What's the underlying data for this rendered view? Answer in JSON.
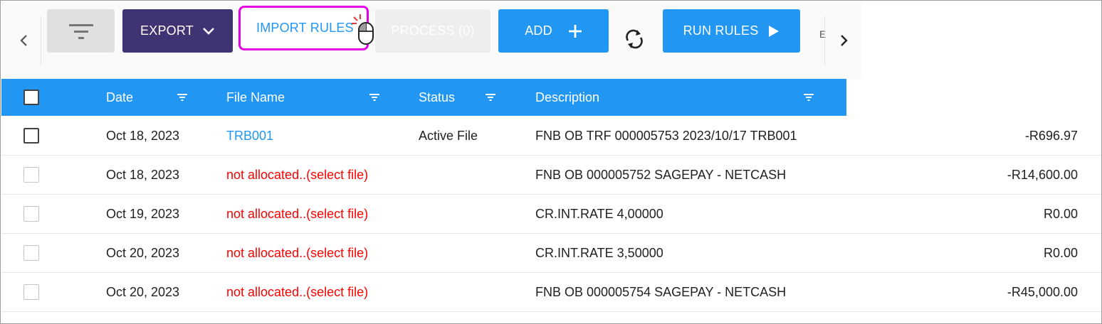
{
  "toolbar": {
    "export_label": "EXPORT",
    "import_rules_label": "IMPORT RULES",
    "process_label": "PROCESS (0)",
    "add_label": "ADD",
    "run_rules_label": "RUN RULES",
    "overflow_label": "E",
    "accent": "#2196f3",
    "export_color": "#3f3373",
    "highlight_color": "#e600e6"
  },
  "table": {
    "header_color": "#2196f3",
    "columns": [
      "Date",
      "File Name",
      "Status",
      "Description"
    ],
    "rows": [
      {
        "date": "Oct 18, 2023",
        "file": "TRB001",
        "status": "Active File",
        "description": "FNB OB TRF 000005753 2023/10/17 TRB001",
        "amount": "-R696.97"
      },
      {
        "date": "Oct 18, 2023",
        "file": "not allocated..(select file)",
        "status": "",
        "description": "FNB OB 000005752 SAGEPAY - NETCASH",
        "amount": "-R14,600.00"
      },
      {
        "date": "Oct 19, 2023",
        "file": "not allocated..(select file)",
        "status": "",
        "description": "CR.INT.RATE 4,00000",
        "amount": "R0.00"
      },
      {
        "date": "Oct 20, 2023",
        "file": "not allocated..(select file)",
        "status": "",
        "description": "CR.INT.RATE 3,50000",
        "amount": "R0.00"
      },
      {
        "date": "Oct 20, 2023",
        "file": "not allocated..(select file)",
        "status": "",
        "description": "FNB OB 000005754 SAGEPAY - NETCASH",
        "amount": "-R45,000.00"
      }
    ]
  }
}
